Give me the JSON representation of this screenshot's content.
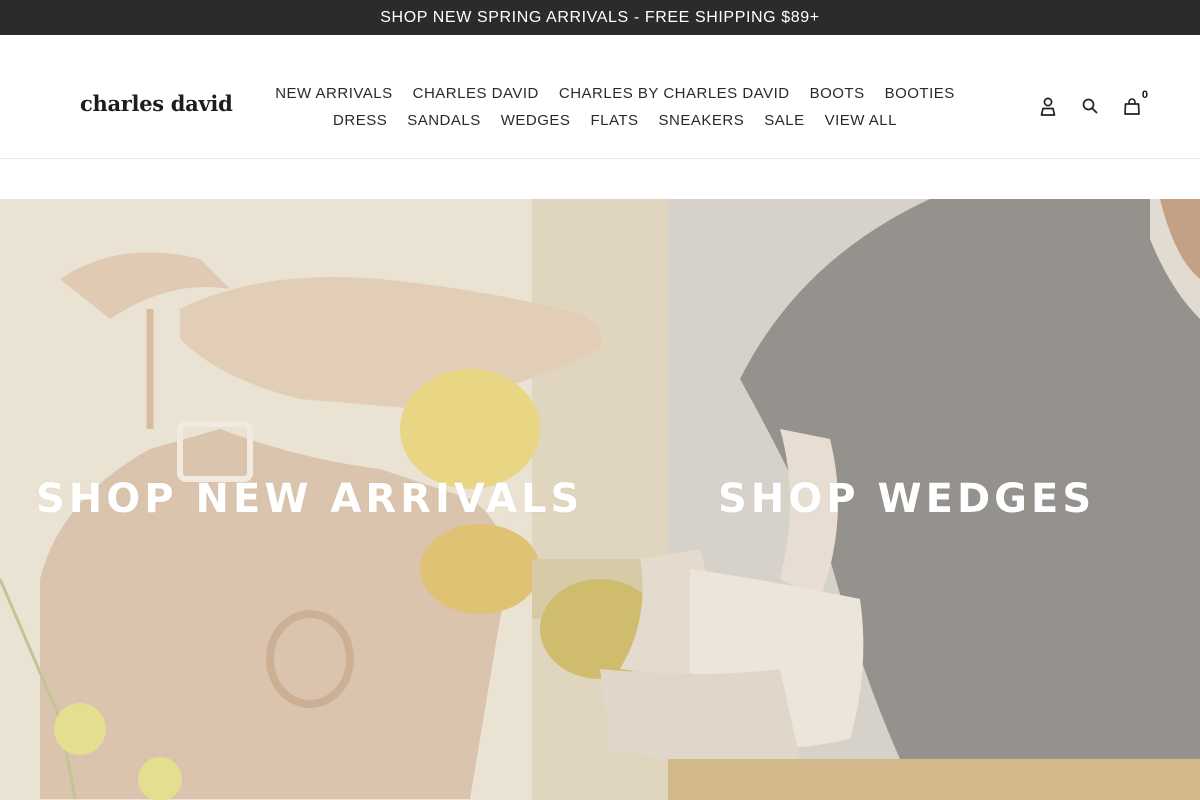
{
  "announcement": {
    "text": "SHOP NEW SPRING ARRIVALS - FREE SHIPPING $89+"
  },
  "header": {
    "logo": "charles david",
    "nav_row1": [
      "NEW ARRIVALS",
      "CHARLES DAVID",
      "CHARLES BY CHARLES DAVID",
      "BOOTS",
      "BOOTIES"
    ],
    "nav_row2": [
      "DRESS",
      "SANDALS",
      "WEDGES",
      "FLATS",
      "SNEAKERS",
      "SALE",
      "VIEW ALL"
    ],
    "utilities": {
      "account_icon": "user-icon",
      "search_icon": "search-icon",
      "cart_icon": "bag-icon",
      "cart_count": "0"
    }
  },
  "hero": {
    "left_title": "SHOP NEW ARRIVALS",
    "right_title": "SHOP WEDGES"
  },
  "colors": {
    "announcement_bg": "#2b2b2b",
    "hero_left_bg": "#e6dcc9",
    "hero_right_bg": "#cfc8bd",
    "skirt": "#7e7a76"
  }
}
